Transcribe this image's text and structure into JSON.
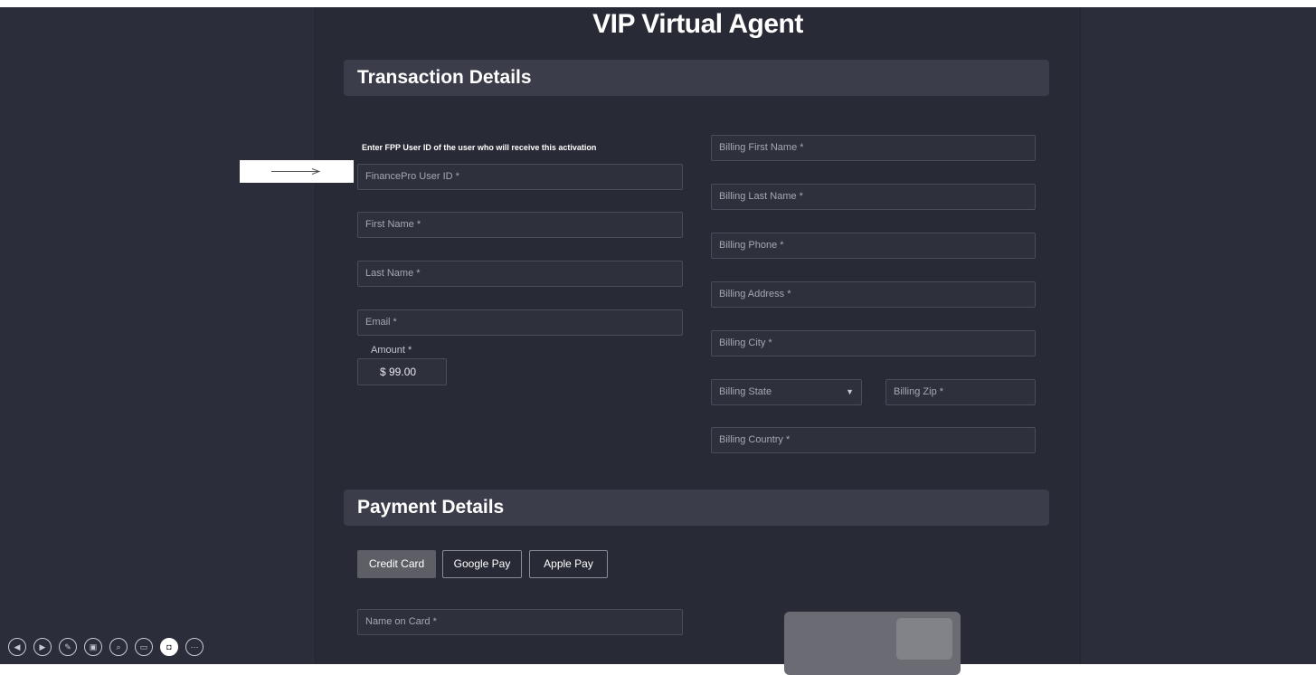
{
  "page": {
    "title": "VIP Virtual Agent"
  },
  "transaction": {
    "heading": "Transaction Details",
    "hint": "Enter FPP User ID of the user who will receive this activation",
    "left_fields": [
      "FinancePro User ID *",
      "First Name *",
      "Last Name *",
      "Email *"
    ],
    "amount_label": "Amount *",
    "amount_value": "$ 99.00",
    "billing": {
      "first_name": "Billing First Name *",
      "last_name": "Billing Last Name *",
      "phone": "Billing Phone *",
      "address": "Billing Address *",
      "city": "Billing City *",
      "state": "Billing State",
      "zip": "Billing Zip *",
      "country": "Billing Country *"
    }
  },
  "payment": {
    "heading": "Payment Details",
    "methods": [
      "Credit Card",
      "Google Pay",
      "Apple Pay"
    ],
    "selected_method": "Credit Card",
    "name_on_card": "Name on Card *"
  },
  "toolbar": {
    "icons": [
      "previous-icon",
      "next-icon",
      "pen-icon",
      "pages-icon",
      "zoom-icon",
      "captions-icon",
      "camera-icon",
      "more-icon"
    ]
  }
}
